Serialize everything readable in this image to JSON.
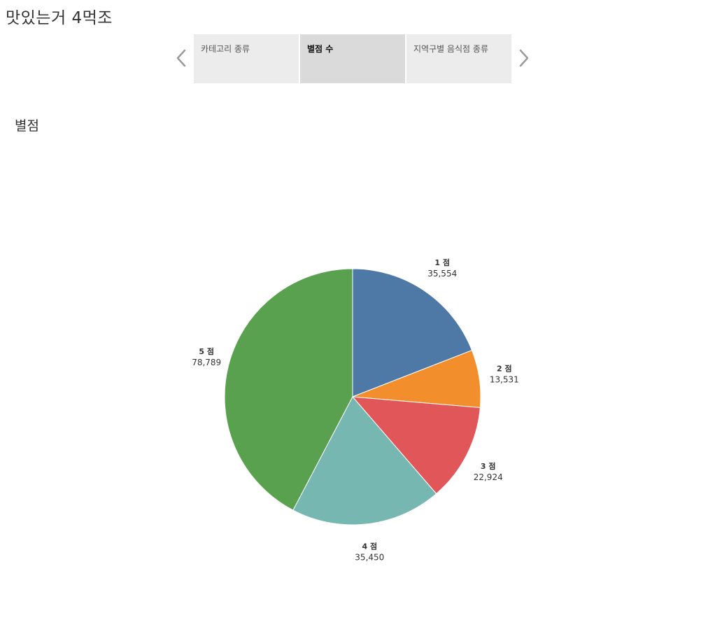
{
  "story": {
    "title": "맛있는거 4먹조"
  },
  "tabs": [
    {
      "label": "카테고리 종류",
      "active": false
    },
    {
      "label": "별점 수",
      "active": true
    },
    {
      "label": "지역구별 음식점 종류",
      "active": false
    }
  ],
  "nav": {
    "prev_icon": "chevron-left-icon",
    "next_icon": "chevron-right-icon"
  },
  "sheet": {
    "title": "별점"
  },
  "chart_data": {
    "type": "pie",
    "title": "별점",
    "slices": [
      {
        "label": "1 점",
        "value": 35554,
        "value_label": "35,554",
        "color": "#4e79a7"
      },
      {
        "label": "2 점",
        "value": 13531,
        "value_label": "13,531",
        "color": "#f28e2b"
      },
      {
        "label": "3 점",
        "value": 22924,
        "value_label": "22,924",
        "color": "#e15759"
      },
      {
        "label": "4 점",
        "value": 35450,
        "value_label": "35,450",
        "color": "#76b7b2"
      },
      {
        "label": "5 점",
        "value": 78789,
        "value_label": "78,789",
        "color": "#59a14f"
      }
    ]
  }
}
